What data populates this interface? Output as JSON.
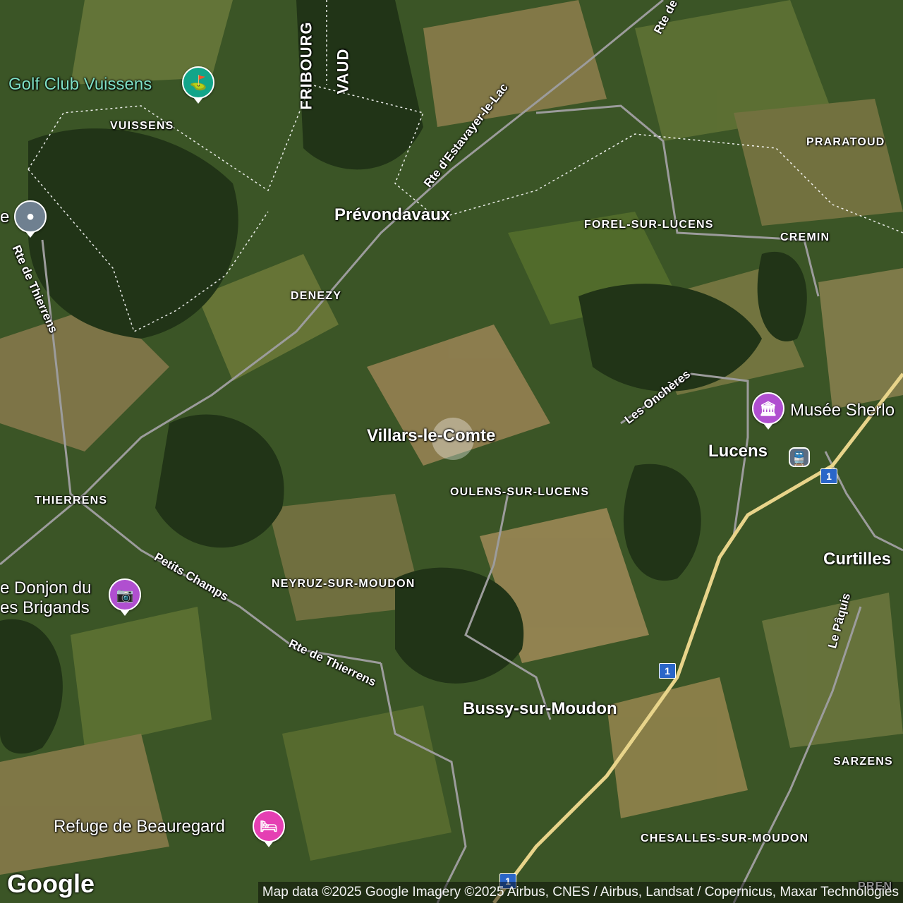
{
  "map": {
    "towns": [
      {
        "id": "prevondavaux",
        "name": "Prévondavaux"
      },
      {
        "id": "villars",
        "name": "Villars-le-Comte"
      },
      {
        "id": "lucens",
        "name": "Lucens"
      },
      {
        "id": "curtilles",
        "name": "Curtilles"
      },
      {
        "id": "bussy",
        "name": "Bussy-sur-Moudon"
      }
    ],
    "villages": [
      {
        "id": "vuissens",
        "name": "VUISSENS"
      },
      {
        "id": "praratoud",
        "name": "PRARATOUD"
      },
      {
        "id": "forel",
        "name": "FOREL-SUR-LUCENS"
      },
      {
        "id": "cremin",
        "name": "CREMIN"
      },
      {
        "id": "denezy",
        "name": "DENEZY"
      },
      {
        "id": "thierrens",
        "name": "THIERRENS"
      },
      {
        "id": "oulens",
        "name": "OULENS-SUR-LUCENS"
      },
      {
        "id": "neyruz",
        "name": "NEYRUZ-SUR-MOUDON"
      },
      {
        "id": "sarzens",
        "name": "SARZENS"
      },
      {
        "id": "chesalles",
        "name": "CHESALLES-SUR-MOUDON"
      }
    ],
    "borders": [
      {
        "id": "fribourg",
        "name": "FRIBOURG"
      },
      {
        "id": "vaud",
        "name": "VAUD"
      }
    ],
    "roads": [
      {
        "id": "estavayer",
        "name": "Rte d'Estavayer-le-Lac"
      },
      {
        "id": "thierrens-n",
        "name": "Rte de Thierrens"
      },
      {
        "id": "thierrens-s",
        "name": "Rte de Thierrens"
      },
      {
        "id": "petits-champs",
        "name": "Petits Champs"
      },
      {
        "id": "onchers",
        "name": "Les Onchères"
      },
      {
        "id": "paquis",
        "name": "Le Pâquis"
      },
      {
        "id": "rte-de-top",
        "name": "Rte de"
      }
    ],
    "pois": [
      {
        "id": "golf",
        "name": "Golf Club Vuissens",
        "icon": "golf-icon",
        "color": "#12a58a"
      },
      {
        "id": "musee",
        "name": "Musée Sherlo",
        "icon": "museum-icon",
        "color": "#b04fd0"
      },
      {
        "id": "donjon",
        "name": "e Donjon du\nes Brigands",
        "icon": "camera-icon",
        "color": "#b04fd0"
      },
      {
        "id": "refuge",
        "name": "Refuge de Beauregard",
        "icon": "bed-icon",
        "color": "#e53fb3"
      },
      {
        "id": "pin-left",
        "name": "e",
        "icon": "place-icon",
        "color": "#6f8090"
      }
    ],
    "highway_shield": "1",
    "partial_bottom_label": "PREN"
  },
  "footer": {
    "logo": "Google",
    "attribution": "Map data ©2025 Google Imagery ©2025 Airbus, CNES / Airbus, Landsat / Copernicus, Maxar Technologies"
  },
  "colors": {
    "forest": "#23381a",
    "field_green": "#4f6b2c",
    "field_tan": "#a58a5a",
    "highway": "#e8d48a",
    "road": "#9a9a9a"
  }
}
